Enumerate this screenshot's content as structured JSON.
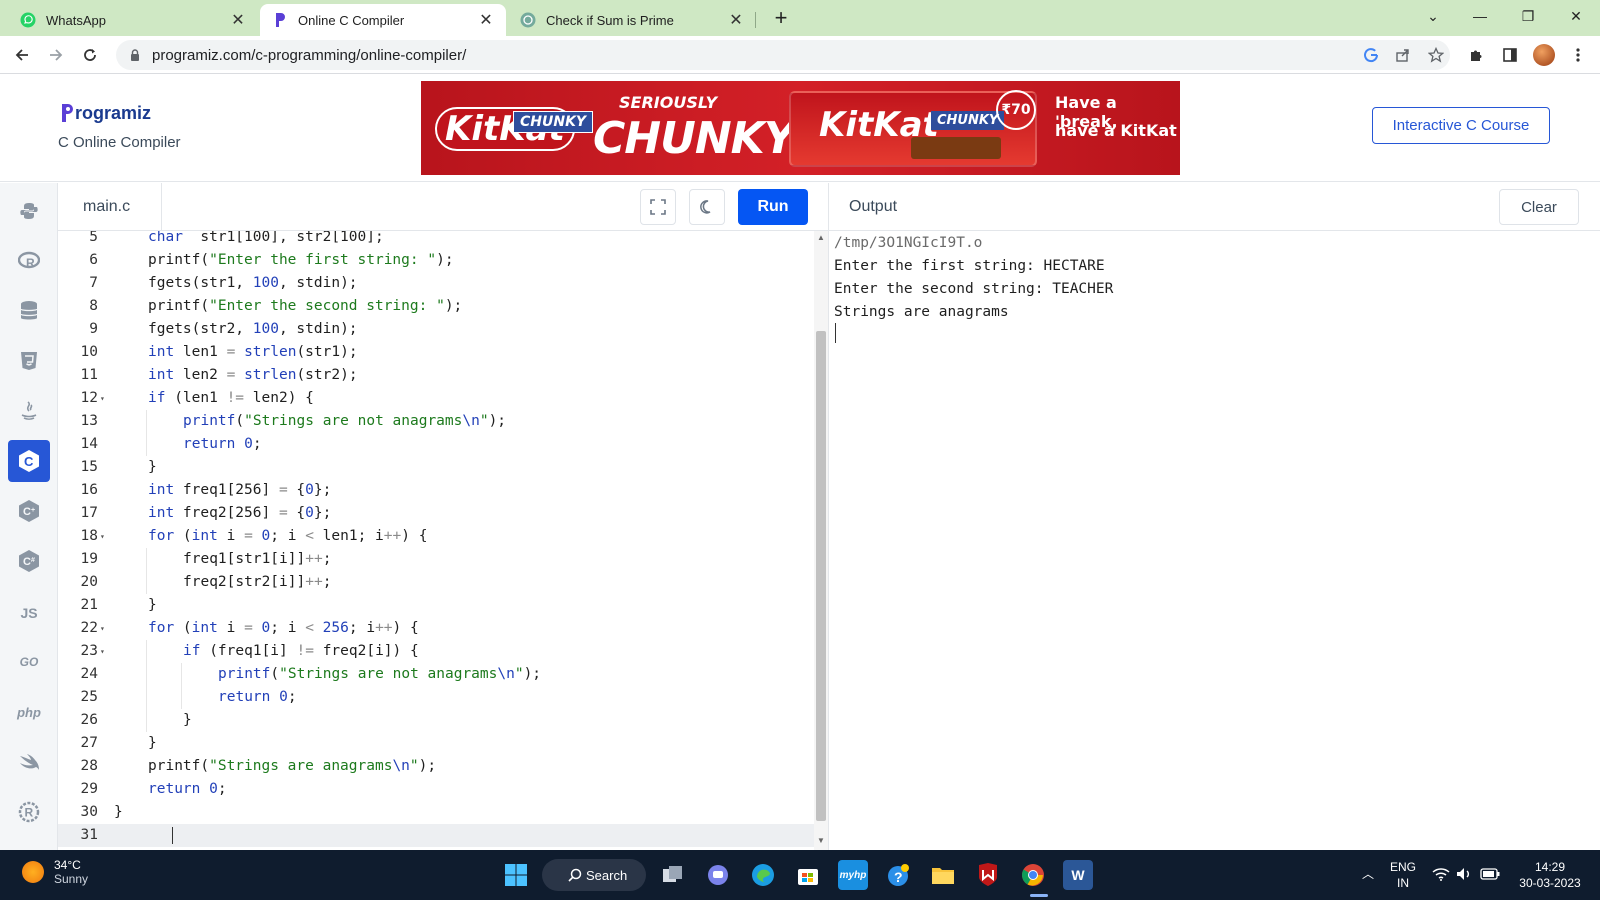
{
  "browser": {
    "tabs": [
      {
        "title": "WhatsApp",
        "icon": "whatsapp-icon",
        "active": false
      },
      {
        "title": "Online C Compiler",
        "icon": "programiz-icon",
        "active": true
      },
      {
        "title": "Check if Sum is Prime",
        "icon": "chatgpt-icon",
        "active": false
      }
    ],
    "address": "programiz.com/c-programming/online-compiler/"
  },
  "site": {
    "brand": "rogramiz",
    "subtitle": "C Online Compiler",
    "course_button": "Interactive C Course",
    "ad": {
      "brand_word": "KitKat",
      "chunky_tag": "CHUNKY",
      "headline_top": "SERIOUSLY",
      "headline_main": "CHUNKY",
      "price": "₹70",
      "tagline_1": "Have a 'break,",
      "tagline_2": "have a KitKat"
    }
  },
  "languages": [
    {
      "name": "python-icon",
      "label": ""
    },
    {
      "name": "r-icon",
      "label": "R"
    },
    {
      "name": "sql-icon",
      "label": ""
    },
    {
      "name": "html-icon",
      "label": "5"
    },
    {
      "name": "java-icon",
      "label": ""
    },
    {
      "name": "c-icon",
      "label": "C"
    },
    {
      "name": "cpp-icon",
      "label": "C"
    },
    {
      "name": "csharp-icon",
      "label": "C"
    },
    {
      "name": "js-icon",
      "label": "JS"
    },
    {
      "name": "go-icon",
      "label": "GO"
    },
    {
      "name": "php-icon",
      "label": "php"
    },
    {
      "name": "swift-icon",
      "label": ""
    },
    {
      "name": "rust-icon",
      "label": "R"
    }
  ],
  "editor": {
    "filename": "main.c",
    "run_label": "Run",
    "lines": [
      {
        "n": "5",
        "fold": false,
        "indent": 1,
        "tokens": [
          [
            "kw",
            "char"
          ],
          [
            "",
            "  str1[100], str2[100];"
          ]
        ]
      },
      {
        "n": "6",
        "fold": false,
        "indent": 1,
        "tokens": [
          [
            "",
            "printf("
          ],
          [
            "str",
            "\"Enter the first string: \""
          ],
          [
            "",
            ");"
          ]
        ]
      },
      {
        "n": "7",
        "fold": false,
        "indent": 1,
        "tokens": [
          [
            "",
            "fgets(str1, "
          ],
          [
            "num",
            "100"
          ],
          [
            "",
            ", stdin);"
          ]
        ]
      },
      {
        "n": "8",
        "fold": false,
        "indent": 1,
        "tokens": [
          [
            "",
            "printf("
          ],
          [
            "str",
            "\"Enter the second string: \""
          ],
          [
            "",
            ");"
          ]
        ]
      },
      {
        "n": "9",
        "fold": false,
        "indent": 1,
        "tokens": [
          [
            "",
            "fgets(str2, "
          ],
          [
            "num",
            "100"
          ],
          [
            "",
            ", stdin);"
          ]
        ]
      },
      {
        "n": "10",
        "fold": false,
        "indent": 1,
        "tokens": [
          [
            "kw",
            "int"
          ],
          [
            "",
            " len1 "
          ],
          [
            "op",
            "="
          ],
          [
            "",
            " "
          ],
          [
            "kw",
            "strlen"
          ],
          [
            "",
            "(str1);"
          ]
        ]
      },
      {
        "n": "11",
        "fold": false,
        "indent": 1,
        "tokens": [
          [
            "kw",
            "int"
          ],
          [
            "",
            " len2 "
          ],
          [
            "op",
            "="
          ],
          [
            "",
            " "
          ],
          [
            "kw",
            "strlen"
          ],
          [
            "",
            "(str2);"
          ]
        ]
      },
      {
        "n": "12",
        "fold": true,
        "indent": 1,
        "tokens": [
          [
            "kw",
            "if"
          ],
          [
            "",
            " (len1 "
          ],
          [
            "op",
            "!="
          ],
          [
            "",
            " len2) {"
          ]
        ]
      },
      {
        "n": "13",
        "fold": false,
        "indent": 2,
        "tokens": [
          [
            "kw",
            "printf"
          ],
          [
            "",
            "("
          ],
          [
            "str",
            "\"Strings are not anagrams"
          ],
          [
            "kw",
            "\\n"
          ],
          [
            "str",
            "\""
          ],
          [
            "",
            ");"
          ]
        ]
      },
      {
        "n": "14",
        "fold": false,
        "indent": 2,
        "tokens": [
          [
            "kw",
            "return"
          ],
          [
            "",
            " "
          ],
          [
            "num",
            "0"
          ],
          [
            "",
            ";"
          ]
        ]
      },
      {
        "n": "15",
        "fold": false,
        "indent": 1,
        "tokens": [
          [
            "",
            "}"
          ]
        ]
      },
      {
        "n": "16",
        "fold": false,
        "indent": 1,
        "tokens": [
          [
            "kw",
            "int"
          ],
          [
            "",
            " freq1[256] "
          ],
          [
            "op",
            "="
          ],
          [
            "",
            " {"
          ],
          [
            "num",
            "0"
          ],
          [
            "",
            "};"
          ]
        ]
      },
      {
        "n": "17",
        "fold": false,
        "indent": 1,
        "tokens": [
          [
            "kw",
            "int"
          ],
          [
            "",
            " freq2[256] "
          ],
          [
            "op",
            "="
          ],
          [
            "",
            " {"
          ],
          [
            "num",
            "0"
          ],
          [
            "",
            "};"
          ]
        ]
      },
      {
        "n": "18",
        "fold": true,
        "indent": 1,
        "tokens": [
          [
            "kw",
            "for"
          ],
          [
            "",
            " ("
          ],
          [
            "kw",
            "int"
          ],
          [
            "",
            " i "
          ],
          [
            "op",
            "="
          ],
          [
            "",
            " "
          ],
          [
            "num",
            "0"
          ],
          [
            "",
            "; i "
          ],
          [
            "op",
            "<"
          ],
          [
            "",
            " len1; i"
          ],
          [
            "op",
            "++"
          ],
          [
            "",
            ") {"
          ]
        ]
      },
      {
        "n": "19",
        "fold": false,
        "indent": 2,
        "tokens": [
          [
            "",
            "freq1[str1[i]]"
          ],
          [
            "op",
            "++"
          ],
          [
            "",
            ";"
          ]
        ]
      },
      {
        "n": "20",
        "fold": false,
        "indent": 2,
        "tokens": [
          [
            "",
            "freq2[str2[i]]"
          ],
          [
            "op",
            "++"
          ],
          [
            "",
            ";"
          ]
        ]
      },
      {
        "n": "21",
        "fold": false,
        "indent": 1,
        "tokens": [
          [
            "",
            "}"
          ]
        ]
      },
      {
        "n": "22",
        "fold": true,
        "indent": 1,
        "tokens": [
          [
            "kw",
            "for"
          ],
          [
            "",
            " ("
          ],
          [
            "kw",
            "int"
          ],
          [
            "",
            " i "
          ],
          [
            "op",
            "="
          ],
          [
            "",
            " "
          ],
          [
            "num",
            "0"
          ],
          [
            "",
            "; i "
          ],
          [
            "op",
            "<"
          ],
          [
            "",
            " "
          ],
          [
            "num",
            "256"
          ],
          [
            "",
            "; i"
          ],
          [
            "op",
            "++"
          ],
          [
            "",
            ") {"
          ]
        ]
      },
      {
        "n": "23",
        "fold": true,
        "indent": 2,
        "tokens": [
          [
            "kw",
            "if"
          ],
          [
            "",
            " (freq1[i] "
          ],
          [
            "op",
            "!="
          ],
          [
            "",
            " freq2[i]) {"
          ]
        ]
      },
      {
        "n": "24",
        "fold": false,
        "indent": 3,
        "tokens": [
          [
            "kw",
            "printf"
          ],
          [
            "",
            "("
          ],
          [
            "str",
            "\"Strings are not anagrams"
          ],
          [
            "kw",
            "\\n"
          ],
          [
            "str",
            "\""
          ],
          [
            "",
            ");"
          ]
        ]
      },
      {
        "n": "25",
        "fold": false,
        "indent": 3,
        "tokens": [
          [
            "kw",
            "return"
          ],
          [
            "",
            " "
          ],
          [
            "num",
            "0"
          ],
          [
            "",
            ";"
          ]
        ]
      },
      {
        "n": "26",
        "fold": false,
        "indent": 2,
        "tokens": [
          [
            "",
            "}"
          ]
        ]
      },
      {
        "n": "27",
        "fold": false,
        "indent": 1,
        "tokens": [
          [
            "",
            "}"
          ]
        ]
      },
      {
        "n": "28",
        "fold": false,
        "indent": 1,
        "tokens": [
          [
            "",
            "printf("
          ],
          [
            "str",
            "\"Strings are anagrams"
          ],
          [
            "kw",
            "\\n"
          ],
          [
            "str",
            "\""
          ],
          [
            "",
            ");"
          ]
        ]
      },
      {
        "n": "29",
        "fold": false,
        "indent": 1,
        "tokens": [
          [
            "kw",
            "return"
          ],
          [
            "",
            " "
          ],
          [
            "num",
            "0"
          ],
          [
            "",
            ";"
          ]
        ]
      },
      {
        "n": "30",
        "fold": false,
        "indent": 0,
        "tokens": [
          [
            "",
            "}"
          ]
        ]
      },
      {
        "n": "31",
        "fold": false,
        "indent": 0,
        "tokens": [],
        "current": true
      }
    ]
  },
  "output": {
    "title": "Output",
    "clear_label": "Clear",
    "lines": [
      "/tmp/3O1NGIcI9T.o",
      "Enter the first string: HECTARE",
      "Enter the second string: TEACHER",
      "Strings are anagrams"
    ]
  },
  "taskbar": {
    "temp": "34°C",
    "condition": "Sunny",
    "search_label": "Search",
    "lang_1": "ENG",
    "lang_2": "IN",
    "time": "14:29",
    "date": "30-03-2023"
  }
}
